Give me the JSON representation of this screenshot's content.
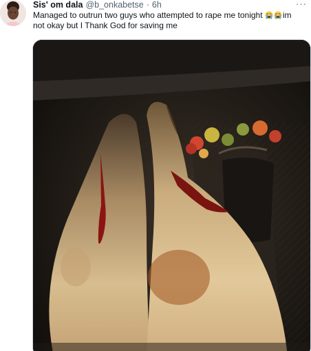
{
  "tweet": {
    "author_name": "Sis' om dala",
    "handle": "@b_onkabetse",
    "separator": "·",
    "time": "6h",
    "more_label": "···",
    "text_before_emoji": "Managed to outrun two guys who attempted to rape me tonight ",
    "text_after_emoji": "im not okay but I Thank God for saving me",
    "emojis": [
      "loudly-crying-face-icon",
      "loudly-crying-face-icon"
    ]
  },
  "colors": {
    "name": "#0f1419",
    "secondary": "#536471",
    "media_border": "#cfd9de"
  }
}
